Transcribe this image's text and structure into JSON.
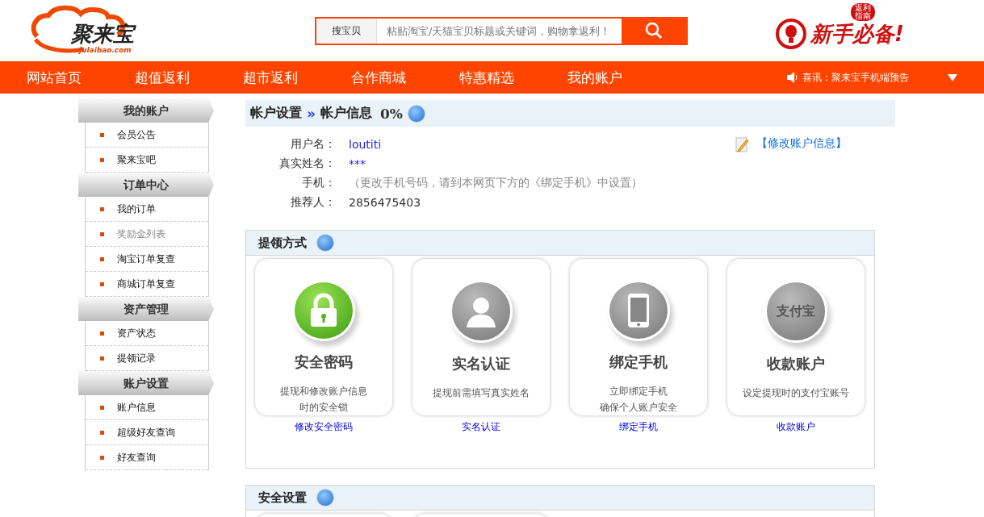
{
  "header": {
    "logo": {
      "name": "聚来宝",
      "domain": "julaibao.com"
    },
    "search": {
      "tab": "搜宝贝",
      "placeholder": "粘贴淘宝/天猫宝贝标题或关键词，购物拿返利！"
    },
    "promo": {
      "badge": "返利指南",
      "title": "新手必备!"
    }
  },
  "nav": {
    "items": [
      {
        "label": "网站首页",
        "selected": false
      },
      {
        "label": "超值返利",
        "selected": false
      },
      {
        "label": "超市返利",
        "selected": false
      },
      {
        "label": "合作商城",
        "selected": false
      },
      {
        "label": "特惠精选",
        "selected": false
      },
      {
        "label": "我的账户",
        "selected": false
      }
    ],
    "notice": "喜讯：聚来宝手机端预告"
  },
  "sidebar": [
    {
      "title": "我的账户",
      "items": [
        {
          "label": "会员公告",
          "disabled": false
        },
        {
          "label": "聚来宝吧",
          "disabled": false
        }
      ]
    },
    {
      "title": "订单中心",
      "items": [
        {
          "label": "我的订单",
          "disabled": false
        },
        {
          "label": "奖励金列表",
          "disabled": true
        },
        {
          "label": "淘宝订单复查",
          "disabled": false
        },
        {
          "label": "商城订单复查",
          "disabled": false
        }
      ]
    },
    {
      "title": "资产管理",
      "items": [
        {
          "label": "资产状态",
          "disabled": false
        },
        {
          "label": "提领记录",
          "disabled": false
        }
      ]
    },
    {
      "title": "账户设置",
      "items": [
        {
          "label": "账户信息",
          "disabled": false
        },
        {
          "label": "超级好友查询",
          "disabled": false
        },
        {
          "label": "好友查询",
          "disabled": false
        }
      ]
    }
  ],
  "breadcrumb": {
    "parent": "帐户设置",
    "separator": "»",
    "current": "帐户信息",
    "percent": "0%"
  },
  "account": {
    "edit_link": "【修改账户信息】",
    "fields": [
      {
        "label": "用户名：",
        "value": "loutiti",
        "kind": "link"
      },
      {
        "label": "真实姓名：",
        "value": "***",
        "kind": "link"
      },
      {
        "label": "手机：",
        "value": "（更改手机号码，请到本网页下方的《绑定手机》中设置）",
        "kind": "hint"
      },
      {
        "label": "推荐人：",
        "value": "2856475403",
        "kind": "plain"
      }
    ]
  },
  "sections": [
    {
      "title": "提领方式",
      "cards": [
        {
          "kind": "lock",
          "title": "安全密码",
          "lines": [
            "提现和修改账户信息",
            "时的安全锁"
          ],
          "link": "修改安全密码"
        },
        {
          "kind": "person",
          "title": "实名认证",
          "lines": [
            "提现前需填写真实姓名"
          ],
          "link": "实名认证"
        },
        {
          "kind": "phone",
          "title": "绑定手机",
          "lines": [
            "立即绑定手机",
            "确保个人账户安全"
          ],
          "link": "绑定手机"
        },
        {
          "kind": "alipay",
          "badge": "支付宝",
          "title": "收款账户",
          "lines": [
            "设定提现时的支付宝账号"
          ],
          "link": "收款账户"
        }
      ]
    },
    {
      "title": "安全设置",
      "cards": [
        {
          "kind": "blank"
        },
        {
          "kind": "blank"
        }
      ]
    }
  ]
}
